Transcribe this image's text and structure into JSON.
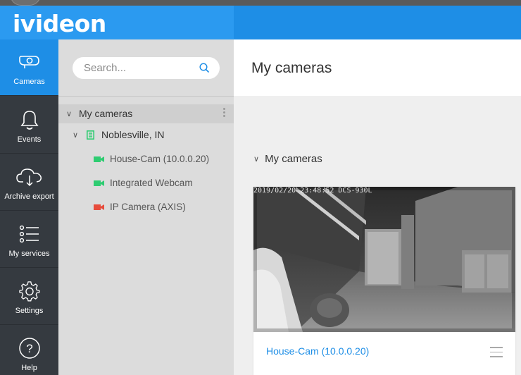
{
  "app": {
    "logo_text": "ivideon",
    "brand_color": "#1e8ee6"
  },
  "nav": {
    "items": [
      {
        "label": "Cameras",
        "icon": "camera-icon",
        "active": true
      },
      {
        "label": "Events",
        "icon": "bell-icon",
        "active": false
      },
      {
        "label": "Archive export",
        "icon": "cloud-download-icon",
        "active": false
      },
      {
        "label": "My services",
        "icon": "list-icon",
        "active": false
      },
      {
        "label": "Settings",
        "icon": "gear-icon",
        "active": false
      },
      {
        "label": "Help",
        "icon": "question-icon",
        "active": false
      }
    ]
  },
  "tree": {
    "search_placeholder": "Search...",
    "root_label": "My cameras",
    "location_label": "Noblesville, IN",
    "cameras": [
      {
        "label": "House-Cam (10.0.0.20)",
        "status_color": "#2ecc71"
      },
      {
        "label": "Integrated Webcam",
        "status_color": "#2ecc71"
      },
      {
        "label": "IP Camera (AXIS)",
        "status_color": "#e74c3c"
      }
    ]
  },
  "main": {
    "title": "My cameras",
    "group_label": "My cameras",
    "card": {
      "camera_name": "House-Cam (10.0.0.20)",
      "overlay_text": "2019/02/20 23:48:52 DCS-930L"
    }
  }
}
